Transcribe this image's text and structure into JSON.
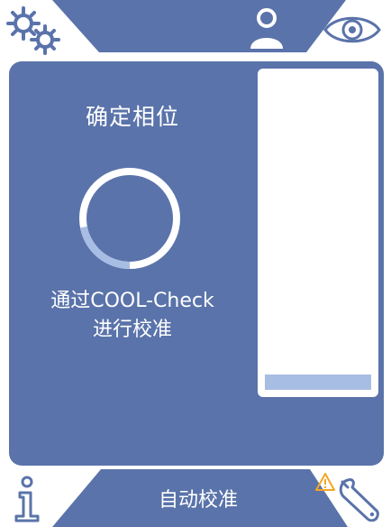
{
  "screen": {
    "status_title": "确定相位",
    "calibration_line1": "通过COOL-Check",
    "calibration_line2": "进行校准",
    "bottom_label": "自动校准"
  },
  "progress_ring": {
    "progress": 0.22
  },
  "level_bar": {
    "fill": 0.05
  },
  "icons": [
    "gear-icon",
    "user-icon",
    "eye-icon",
    "info-icon",
    "warning-icon",
    "wrench-icon"
  ],
  "colors": {
    "panel": "#5a73aa",
    "background": "#ffffff",
    "ring_bg": "#ffffff",
    "ring_progress": "#a8bde3",
    "warning": "#f5a623"
  }
}
